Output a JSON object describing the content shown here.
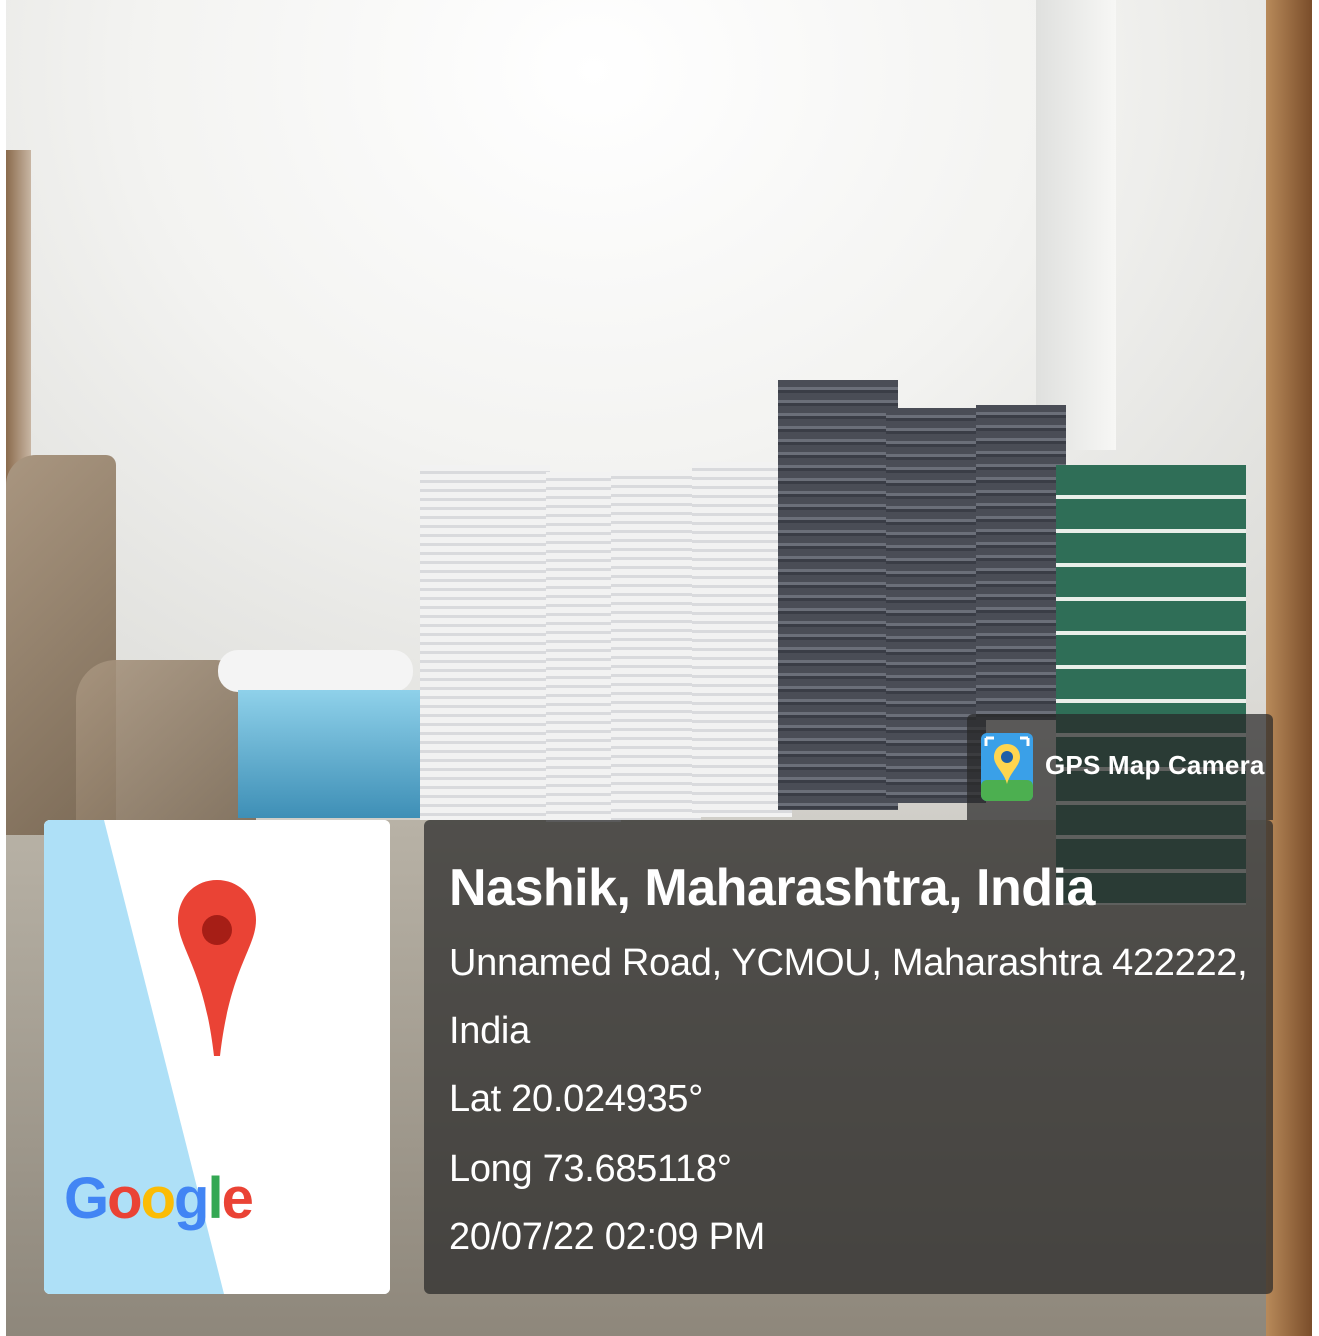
{
  "overlay": {
    "app_name": "GPS Map Camera",
    "location_title": "Nashik, Maharashtra, India",
    "address_line1": "Unnamed Road, YCMOU, Maharashtra 422222,",
    "address_line2": "India",
    "latitude": "Lat 20.024935°",
    "longitude": "Long 73.685118°",
    "datetime": "20/07/22 02:09 PM"
  },
  "map_thumbnail": {
    "logo": "Google",
    "pin_icon": "map-pin-icon",
    "colors": {
      "water": "#aee0f7",
      "land": "#ffffff",
      "pin": "#ea4335",
      "pin_dot": "#a61e16"
    }
  },
  "photo": {
    "subject": "stacks of wrapped paper bundles and boxes against a white wall"
  }
}
